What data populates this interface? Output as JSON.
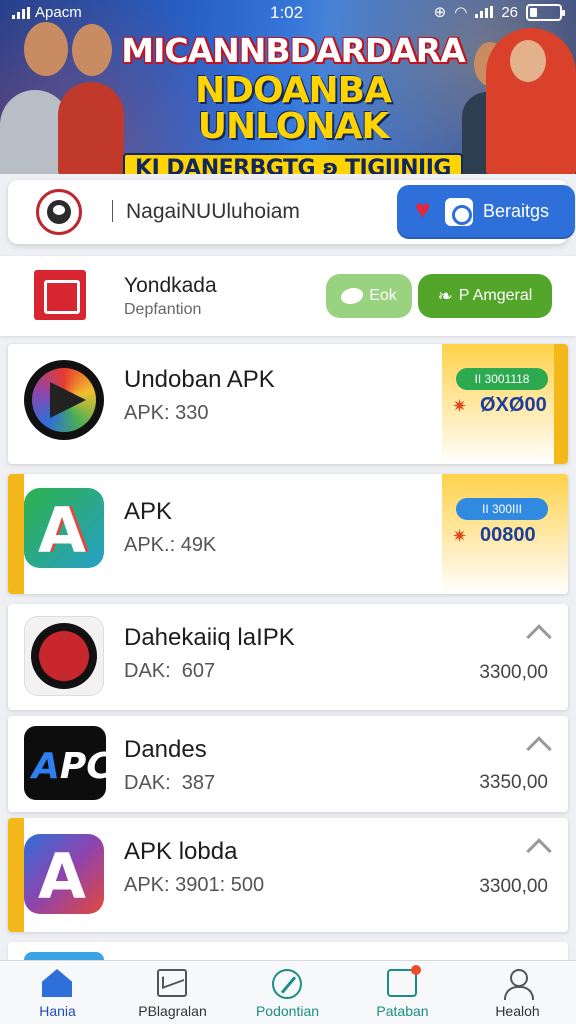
{
  "status_bar": {
    "carrier": "Apacm",
    "time": "1:02",
    "battery_text": "26",
    "battery_level": 0.26
  },
  "banner": {
    "line1": "MICANNBDARDARA",
    "line2": "NDOANBA UNLONAK",
    "line3": "KI DANERBGTG ʚ TIGIINIIG"
  },
  "search": {
    "text": "NagaiNUUluhoiam",
    "button_label": "Beraitgs"
  },
  "developer": {
    "name": "Yondkada",
    "subtitle": "Depfantion",
    "button1_label": "Eok",
    "button2_label": "P Amgeral"
  },
  "apps": [
    {
      "title": "Undoban APK",
      "subtitle": "APK: 330",
      "badge_top": "II 3001118",
      "badge_value": "ØXØ00",
      "badge_color": "#2daa4f"
    },
    {
      "title": "APK",
      "subtitle": "APK.: 49K",
      "badge_top": "II 300III",
      "badge_value": "00800",
      "badge_color": "#2f8ae0"
    },
    {
      "title": "Dahekaiiq laIPK",
      "subtitle": "DAK:  607",
      "price": "3300,00"
    },
    {
      "title": "Dandes",
      "subtitle": "DAK:  387",
      "price": "3350,00",
      "icon_text_a": "A",
      "icon_text_b": "PC"
    },
    {
      "title": "APK lobda",
      "subtitle": "APK: 3901: 500",
      "price": "3300,00"
    }
  ],
  "nav": [
    {
      "label": "Hania",
      "icon": "home-icon"
    },
    {
      "label": "PBlagralan",
      "icon": "mail-icon"
    },
    {
      "label": "Podontian",
      "icon": "compass-icon"
    },
    {
      "label": "Pataban",
      "icon": "clipboard-icon"
    },
    {
      "label": "Healoh",
      "icon": "user-icon"
    }
  ],
  "colors": {
    "primary": "#2f6fd9",
    "accent": "#f4b81b",
    "green": "#54a62b",
    "light_green": "#9ad37f",
    "banner_red": "#c1121f",
    "banner_yellow": "#ffd400"
  }
}
